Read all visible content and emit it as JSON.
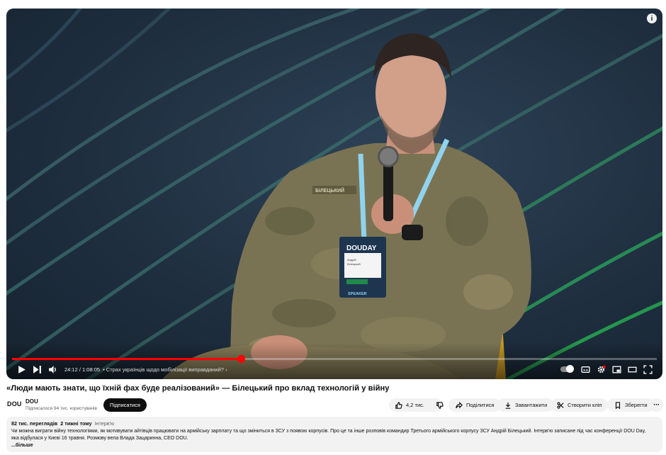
{
  "player": {
    "info_label": "i",
    "time_current": "24:12",
    "time_separator": " / ",
    "time_total": "1:08:05",
    "chapter": "• Страх українців щодо мобілізації виправданий?",
    "chapter_arrow": "›",
    "progress_played_fraction": 0.355,
    "badge": {
      "brand": "DOUDAY",
      "name_line1": "Андрій",
      "name_line2": "Білецький",
      "role": "SPEAKER"
    },
    "patch_text": "БІЛЕЦЬКИЙ"
  },
  "video": {
    "title": "«Люди мають знати, що їхній фах буде реалізований» — Білецький про вклад технологій у війну"
  },
  "channel": {
    "logo": "DOU",
    "name": "DOU",
    "subscribers": "Підписалося 94 тис. користувачів",
    "subscribe_label": "Підписатися"
  },
  "actions": {
    "likes": "4,2 тис.",
    "share": "Поділитися",
    "download": "Завантажити",
    "clip": "Створити кліп",
    "save": "Зберегти",
    "more": "···"
  },
  "description": {
    "views": "82 тис. переглядів",
    "date": "2 тижні тому",
    "tag": "Інтерв'ю",
    "text": "Чи можна виграти війну технологіями, як мотивувати айтівців працювати на армійську зарплату та що зміниться в ЗСУ з появою корпусів. Про це та інше розповів командир Третього армійського корпусу ЗСУ Андрій Білецький. Інтерв'ю записане під час конференції DOU Day, яка відбулася у Києві 16 травня. Розмову вела Влада Зацаринна, CEO DOU.",
    "more": "...більше"
  }
}
